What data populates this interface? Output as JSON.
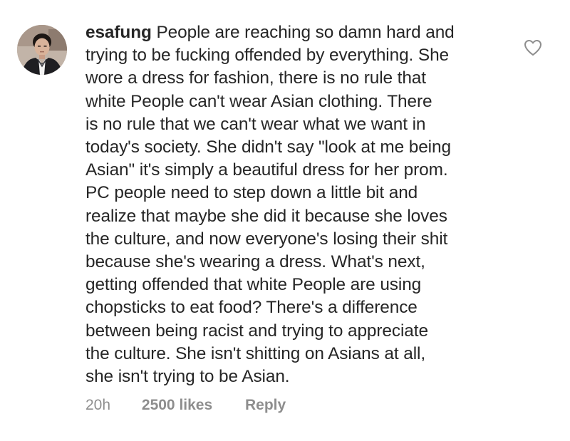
{
  "comment": {
    "username": "esafung",
    "text_lines": [
      "People are reaching so damn hard and",
      "trying to be fucking offended by everything. She",
      "wore a dress for fashion, there is no rule that",
      "white People can't wear Asian clothing. There",
      "is no rule that we can't wear what we want in",
      "today's society. She didn't say \"look at me being",
      "Asian\" it's simply a beautiful dress for her prom.",
      "PC people need to step down a little bit and",
      "realize that maybe she did it because she loves",
      "the culture, and now everyone's losing their shit",
      "because she's wearing a dress. What's next,",
      "getting offended that white People are using",
      "chopsticks to eat food? There's a difference",
      "between being racist and trying to appreciate",
      "the culture. She isn't shitting on Asians at all,",
      "she isn't trying to be Asian."
    ],
    "time_ago": "20h",
    "likes": "2500 likes",
    "reply_label": "Reply",
    "like_icon": "heart-outline-icon"
  },
  "colors": {
    "text": "#262626",
    "meta": "#8e8e8e",
    "icon": "#8e8e8e"
  }
}
